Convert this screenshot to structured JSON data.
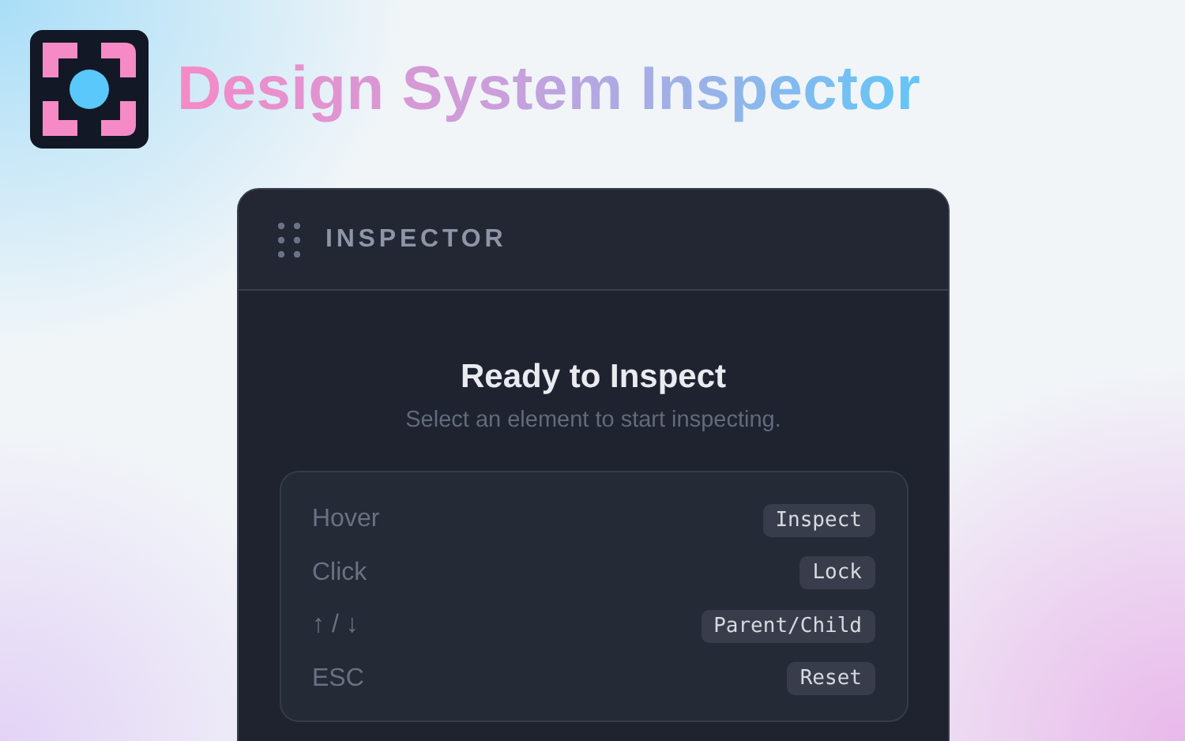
{
  "app": {
    "title": "Design System Inspector"
  },
  "panel": {
    "title": "INSPECTOR",
    "heading": "Ready to Inspect",
    "subtitle": "Select an element to start inspecting.",
    "shortcuts": [
      {
        "action": "Hover",
        "key": "Inspect"
      },
      {
        "action": "Click",
        "key": "Lock"
      },
      {
        "action": "↑ / ↓",
        "key": "Parent/Child"
      },
      {
        "action": "ESC",
        "key": "Reset"
      }
    ]
  }
}
